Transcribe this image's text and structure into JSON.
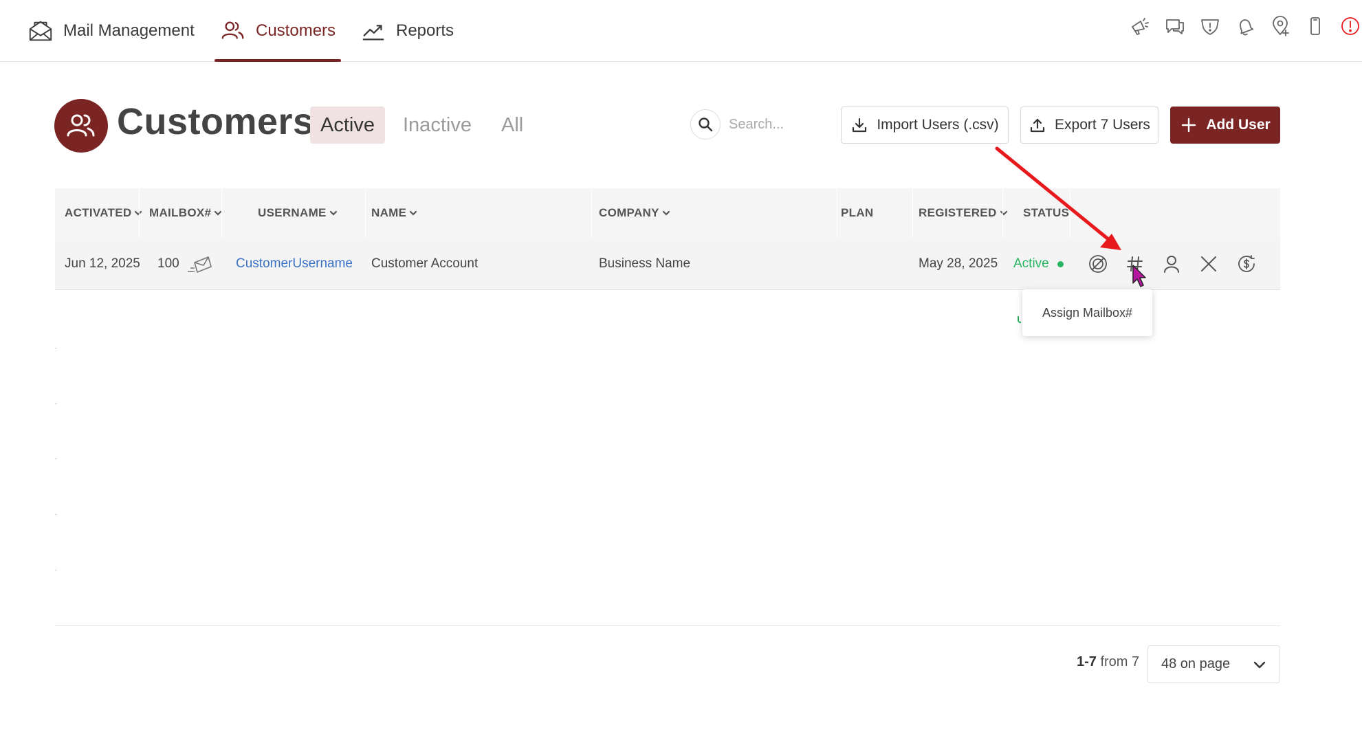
{
  "nav": {
    "items": [
      {
        "label": "Mail Management",
        "icon": "envelope-icon"
      },
      {
        "label": "Customers",
        "icon": "users-icon",
        "active": true
      },
      {
        "label": "Reports",
        "icon": "trend-chart-icon"
      }
    ],
    "right_icons": [
      "megaphone-icon",
      "chat-icon",
      "shield-icon",
      "bell-icon",
      "location-pin-icon",
      "mobile-icon",
      "alert-icon"
    ]
  },
  "page": {
    "title": "Customers",
    "tabs": [
      "Active",
      "Inactive",
      "All"
    ],
    "active_tab": "Active",
    "search_placeholder": "Search...",
    "buttons": {
      "import": "Import Users (.csv)",
      "export": "Export 7 Users",
      "add": "Add User"
    }
  },
  "table": {
    "columns": [
      "ACTIVATED",
      "MAILBOX#",
      "USERNAME",
      "NAME",
      "COMPANY",
      "PLAN",
      "REGISTERED",
      "STATUS"
    ],
    "rows": [
      {
        "activated": "Jun 12, 2025",
        "mailbox": "100",
        "username": "CustomerUsername",
        "name": "Customer Account",
        "company": "Business Name",
        "plan": "",
        "registered": "May 28, 2025",
        "status": "Active"
      }
    ],
    "row_actions": [
      "no-mail-icon",
      "hash-icon",
      "user-icon",
      "close-icon",
      "dollar-refresh-icon"
    ]
  },
  "tooltip": {
    "text": "Assign Mailbox#"
  },
  "pagination": {
    "range": "1-7",
    "from_text": "from 7",
    "per_page": "48 on page"
  },
  "colors": {
    "brand": "#7a2424",
    "active_green": "#27b561",
    "link_blue": "#3b73c4",
    "annotation_red": "#e8191c"
  }
}
